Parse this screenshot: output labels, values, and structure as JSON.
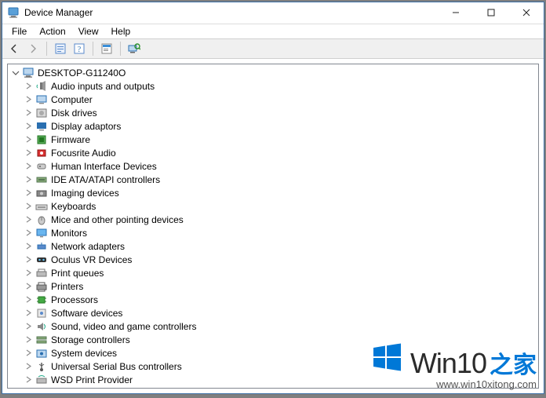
{
  "window": {
    "title": "Device Manager"
  },
  "menu": {
    "items": [
      "File",
      "Action",
      "View",
      "Help"
    ]
  },
  "toolbar": {
    "buttons": [
      {
        "name": "back-icon"
      },
      {
        "name": "forward-icon"
      },
      {
        "sep": true
      },
      {
        "name": "show-hidden-icon"
      },
      {
        "name": "help-icon"
      },
      {
        "sep": true
      },
      {
        "name": "properties-icon"
      },
      {
        "sep": true
      },
      {
        "name": "scan-hardware-icon"
      }
    ]
  },
  "tree": {
    "root": {
      "label": "DESKTOP-G11240O",
      "icon": "computer-icon"
    },
    "children": [
      {
        "label": "Audio inputs and outputs",
        "icon": "audio-icon"
      },
      {
        "label": "Computer",
        "icon": "computer-icon"
      },
      {
        "label": "Disk drives",
        "icon": "disk-icon"
      },
      {
        "label": "Display adaptors",
        "icon": "display-icon"
      },
      {
        "label": "Firmware",
        "icon": "firmware-icon"
      },
      {
        "label": "Focusrite Audio",
        "icon": "audio-dev-icon"
      },
      {
        "label": "Human Interface Devices",
        "icon": "hid-icon"
      },
      {
        "label": "IDE ATA/ATAPI controllers",
        "icon": "ide-icon"
      },
      {
        "label": "Imaging devices",
        "icon": "imaging-icon"
      },
      {
        "label": "Keyboards",
        "icon": "keyboard-icon"
      },
      {
        "label": "Mice and other pointing devices",
        "icon": "mouse-icon"
      },
      {
        "label": "Monitors",
        "icon": "monitor-icon"
      },
      {
        "label": "Network adapters",
        "icon": "network-icon"
      },
      {
        "label": "Oculus VR Devices",
        "icon": "vr-icon"
      },
      {
        "label": "Print queues",
        "icon": "print-queue-icon"
      },
      {
        "label": "Printers",
        "icon": "printer-icon"
      },
      {
        "label": "Processors",
        "icon": "cpu-icon"
      },
      {
        "label": "Software devices",
        "icon": "software-icon"
      },
      {
        "label": "Sound, video and game controllers",
        "icon": "sound-icon"
      },
      {
        "label": "Storage controllers",
        "icon": "storage-icon"
      },
      {
        "label": "System devices",
        "icon": "system-icon"
      },
      {
        "label": "Universal Serial Bus controllers",
        "icon": "usb-icon"
      },
      {
        "label": "WSD Print Provider",
        "icon": "wsd-icon"
      }
    ]
  },
  "watermark": {
    "brand": "Win10",
    "suffix": "之家",
    "url": "www.win10xitong.com"
  }
}
